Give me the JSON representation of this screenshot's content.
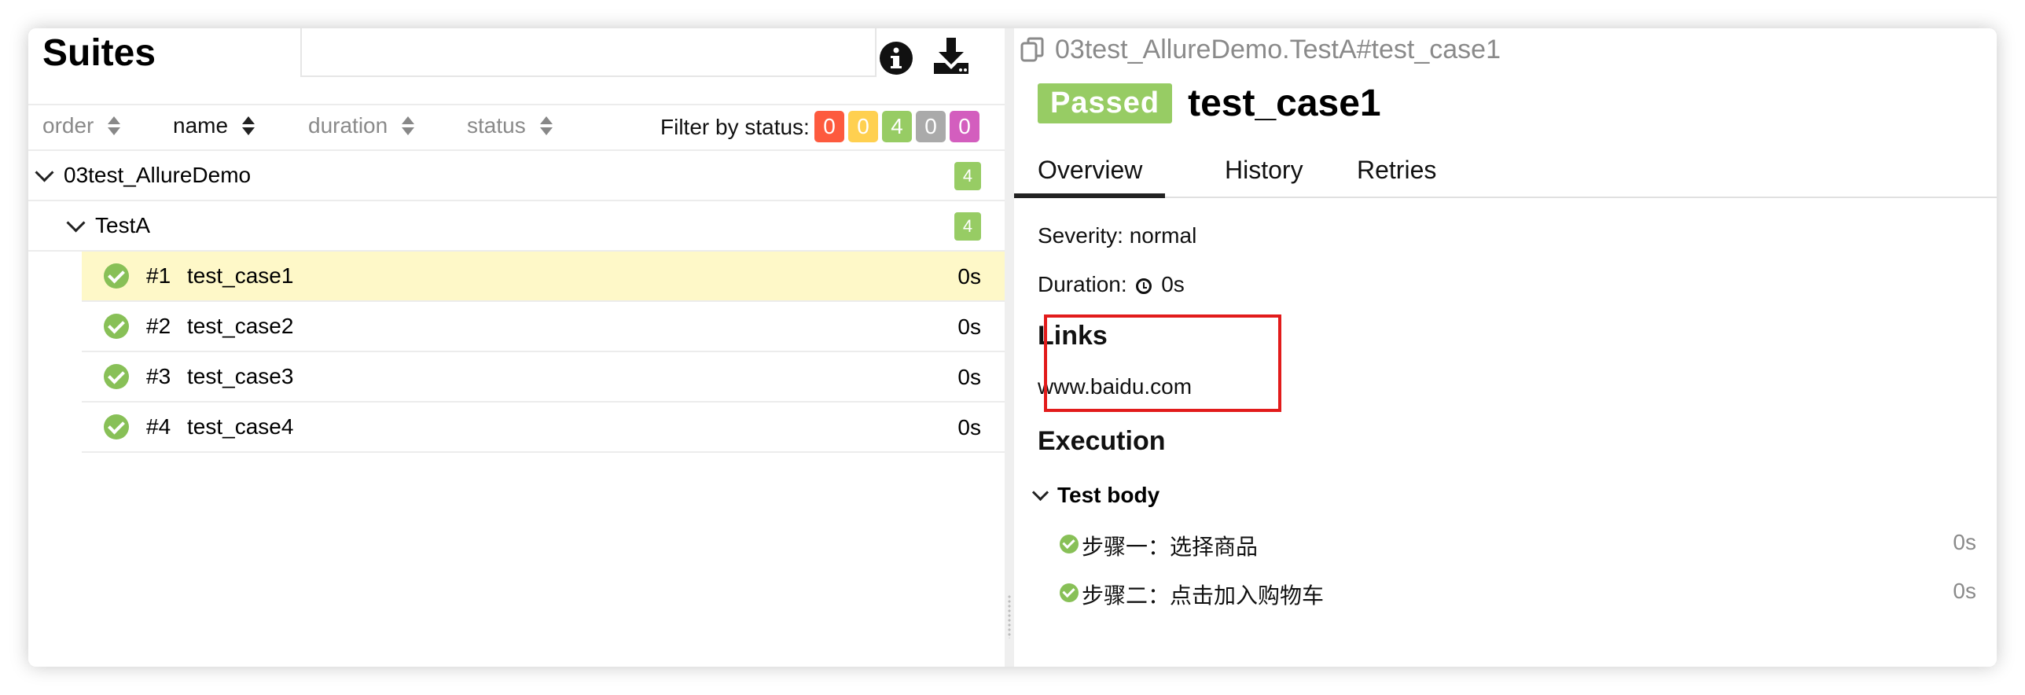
{
  "left": {
    "title": "Suites",
    "search": {
      "value": ""
    },
    "sort": {
      "order": "order",
      "name": "name",
      "duration": "duration",
      "status": "status"
    },
    "filter": {
      "label": "Filter by status:",
      "badges": [
        {
          "count": "0",
          "color": "#fd5a3e"
        },
        {
          "count": "0",
          "color": "#ffd050"
        },
        {
          "count": "4",
          "color": "#97cc64"
        },
        {
          "count": "0",
          "color": "#aaaaaa"
        },
        {
          "count": "0",
          "color": "#d35ebe"
        }
      ]
    },
    "tree": {
      "suite": {
        "name": "03test_AllureDemo",
        "count": "4"
      },
      "group": {
        "name": "TestA",
        "count": "4"
      },
      "cases": [
        {
          "num": "#1",
          "name": "test_case1",
          "duration": "0s"
        },
        {
          "num": "#2",
          "name": "test_case2",
          "duration": "0s"
        },
        {
          "num": "#3",
          "name": "test_case3",
          "duration": "0s"
        },
        {
          "num": "#4",
          "name": "test_case4",
          "duration": "0s"
        }
      ]
    }
  },
  "right": {
    "breadcrumb": "03test_AllureDemo.TestA#test_case1",
    "status": "Passed",
    "title": "test_case1",
    "tabs": [
      "Overview",
      "History",
      "Retries"
    ],
    "severity": "Severity: normal",
    "duration_label": "Duration:",
    "duration_value": "0s",
    "links_heading": "Links",
    "link": "www.baidu.com",
    "execution_heading": "Execution",
    "test_body_label": "Test body",
    "steps": [
      {
        "name": "步骤一：选择商品",
        "duration": "0s"
      },
      {
        "name": "步骤二：点击加入购物车",
        "duration": "0s"
      }
    ]
  },
  "colors": {
    "passed": "#97cc64",
    "selected_row": "#fef8c8",
    "highlight_box": "#e21b1b"
  }
}
